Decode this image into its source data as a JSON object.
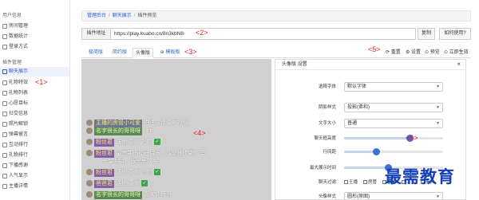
{
  "sidebar": {
    "group1_title": "用户信息",
    "group1_items": [
      {
        "label": "房间管理",
        "active": false
      },
      {
        "label": "数据统计",
        "active": false
      },
      {
        "label": "登录方式",
        "active": false
      }
    ],
    "group2_title": "插件管理",
    "group2_items": [
      {
        "label": "聊天展示",
        "active": true
      },
      {
        "label": "礼物特效",
        "active": false
      },
      {
        "label": "礼物列表",
        "active": false
      },
      {
        "label": "心愿目标",
        "active": false
      },
      {
        "label": "社交信息",
        "active": false
      },
      {
        "label": "照片解锁",
        "active": false
      },
      {
        "label": "弹幕留言",
        "active": false
      },
      {
        "label": "互动排行",
        "active": false
      },
      {
        "label": "礼物排行",
        "active": false
      },
      {
        "label": "下播感谢",
        "active": false
      },
      {
        "label": "人气显示",
        "active": false
      },
      {
        "label": "主播详情",
        "active": false
      }
    ]
  },
  "markers": {
    "m1": "<1>",
    "m2": "<2>",
    "m3": "<3>",
    "m4": "<4>",
    "m5": "<5>",
    "m6": "<6>"
  },
  "breadcrumb": {
    "home": "管理后台",
    "section": "聊天展示",
    "current": "插件预览",
    "sep": "/"
  },
  "url_row": {
    "addon_label": "插件地址",
    "url_value": "https://play.kuabo.cn/8n3kbN8",
    "copy_label": "复制",
    "howto_label": "如何使用?"
  },
  "tabs": [
    {
      "label": "极简版",
      "active": false
    },
    {
      "label": "简约版",
      "active": false
    },
    {
      "label": "头像版",
      "active": true
    },
    {
      "label": "⊕ 模板版",
      "active": false
    }
  ],
  "toolbar": {
    "reset": "⟳ 重置",
    "settings": "⚙ 设置",
    "preview": "⊙ 预览",
    "effective": "⊙ 立即生效"
  },
  "preview_lines": [
    {
      "name": "主播的房管小可爱",
      "name_style": "grey",
      "msg": "进注意请喜欢礼仪",
      "check": false
    },
    {
      "name": "",
      "name_style": "",
      "msg": "",
      "check": false
    },
    {
      "name": "名字很长的哥哥呀",
      "name_style": "green",
      "msg": "hhh",
      "check": false
    },
    {
      "name": "粉丝君",
      "name_style": "purple",
      "msg": "送他 喜欢 礼物",
      "check": true
    },
    {
      "name": "粉丝君",
      "name_style": "purple",
      "msg": "留言并祝福日月光，捉是地上霜。举",
      "check": false
    },
    {
      "name": "",
      "name_style": "",
      "msg": "头望明月，低头思故乡。",
      "check": false
    },
    {
      "name": "",
      "name_style": "",
      "msg": "",
      "check": false
    },
    {
      "name": "粉丝君",
      "name_style": "purple",
      "msg": "送他 喜欢 礼物",
      "check": true
    },
    {
      "name": "爸爸君",
      "name_style": "purple",
      "msg": "送他 喜欢",
      "check": true
    },
    {
      "name": "名字很长的哥哥呀",
      "name_style": "green",
      "msg": "喜欢你哥哥",
      "check": false
    }
  ],
  "panel": {
    "title": "头像版 设置",
    "close": "×",
    "rows": [
      {
        "label": "选择字体",
        "type": "select",
        "value": "默认字体"
      },
      {
        "label": "阴影样式",
        "type": "select",
        "value": "投影(柔和)"
      },
      {
        "label": "文字大小",
        "type": "select",
        "value": "普通"
      },
      {
        "label": "聊天框高度",
        "type": "slider",
        "value": 0.66
      },
      {
        "label": "行间距",
        "type": "slider",
        "value": 0.32
      },
      {
        "label": "最大展示时间",
        "type": "slider",
        "value": 0.44
      },
      {
        "label": "聊天过滤",
        "type": "checks",
        "options": [
          "王播",
          "房管",
          "普通",
          "关注",
          "贵宾"
        ]
      },
      {
        "label": "头像样式",
        "type": "select",
        "value": "圆形(原图)"
      }
    ]
  },
  "watermark": "最需教育",
  "colors": {
    "accent": "#2a5bd7",
    "marker": "#e02020",
    "preview_bg": "#d0d0d0",
    "slider_knob": "#3b6fd2"
  }
}
